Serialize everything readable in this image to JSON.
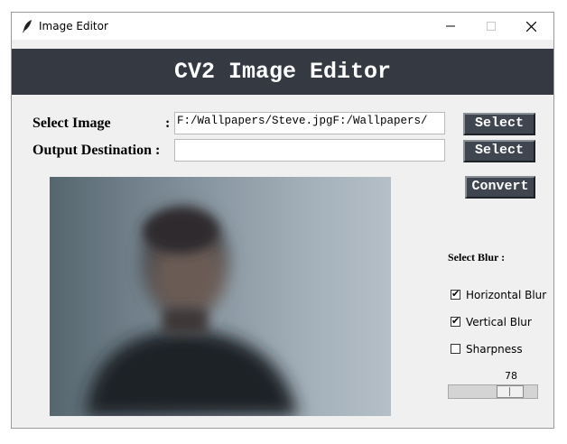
{
  "window": {
    "title": "Image Editor",
    "icons": {
      "app": "feather-icon",
      "minimize": "minimize-icon",
      "maximize": "maximize-icon",
      "close": "close-icon"
    }
  },
  "header": {
    "title": "CV2 Image Editor",
    "background": "#353a42"
  },
  "form": {
    "select_image_label": "Select Image",
    "select_image_colon": ":",
    "select_image_value": "F:/Wallpapers/Steve.jpgF:/Wallpapers/",
    "output_label": "Output Destination :",
    "output_value": "",
    "select_button_label": "Select",
    "select_output_button_label": "Select",
    "convert_button_label": "Convert"
  },
  "blur_panel": {
    "title": "Select Blur :",
    "options": [
      {
        "label": "Horizontal Blur",
        "checked": true
      },
      {
        "label": "Vertical Blur",
        "checked": true
      },
      {
        "label": "Sharpness",
        "checked": false
      }
    ],
    "slider_value": "78",
    "slider_fraction": 0.78
  },
  "preview": {
    "description_icon": "image-preview"
  }
}
